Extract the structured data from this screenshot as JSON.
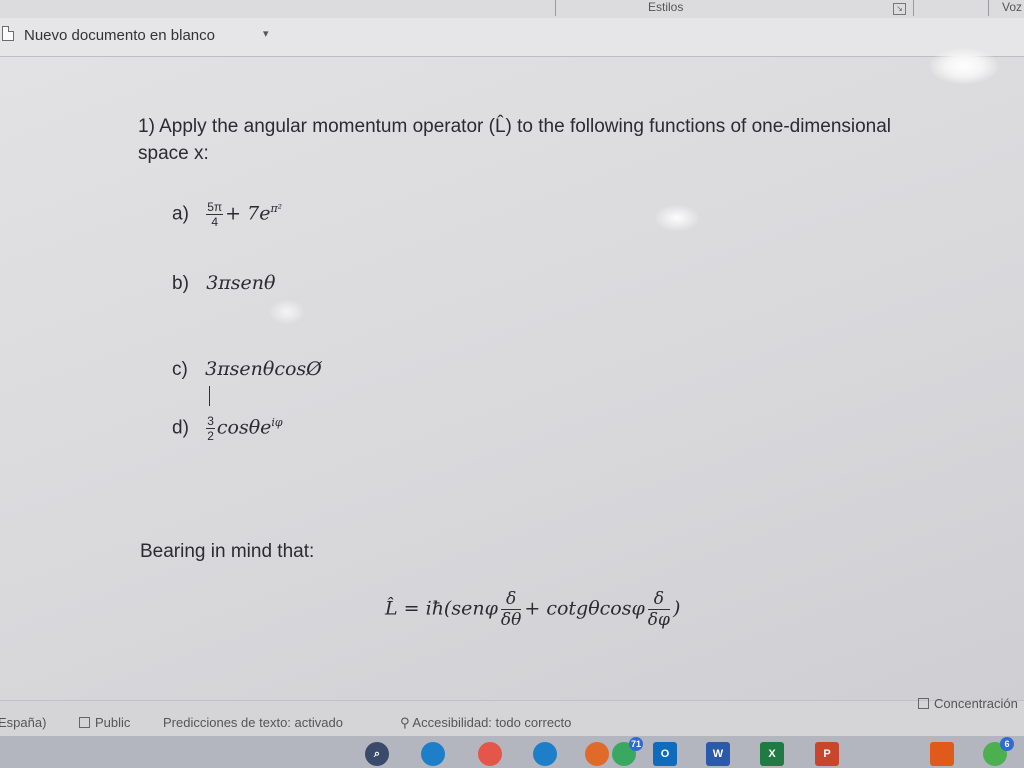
{
  "ribbon": {
    "styles_label": "Estilos",
    "voice_label": "Voz"
  },
  "titlebar": {
    "doc_title": "Nuevo documento en blanco"
  },
  "document": {
    "question": "1) Apply the angular momentum operator (L̂) to the following functions of one-dimensional space x:",
    "items": [
      {
        "label": "a)",
        "frac_num": "5π",
        "frac_den": "4",
        "rest": "+ 7e",
        "sup": "π²"
      },
      {
        "label": "b)",
        "expr": "3πsenθ"
      },
      {
        "label": "c)",
        "expr": "3πsenθcosØ"
      },
      {
        "label": "d)",
        "frac_num": "3",
        "frac_den": "2",
        "expr": "cosθe",
        "sup": "iφ"
      }
    ],
    "bearing": "Bearing in mind that:",
    "formula": {
      "lhs": "L̂ = iħ(senφ",
      "frac1_num": "δ",
      "frac1_den": "δθ",
      "mid": "+ cotgθcosφ",
      "frac2_num": "δ",
      "frac2_den": "δφ",
      "end": ")"
    }
  },
  "statusbar": {
    "language": "España)",
    "sensitivity": "Public",
    "predictions": "Predicciones de texto: activado",
    "accessibility": "Accesibilidad: todo correcto",
    "focus": "Concentración"
  },
  "taskbar": {
    "outlook_letter": "O",
    "word_letter": "W",
    "excel_letter": "X",
    "powerpoint_letter": "P",
    "chrome_badge": "71",
    "notif_badge": "6"
  }
}
